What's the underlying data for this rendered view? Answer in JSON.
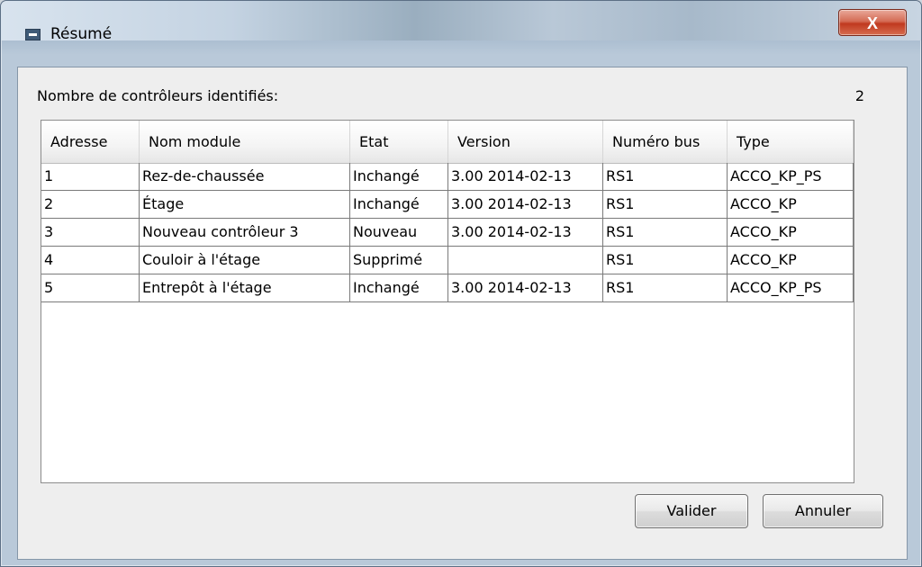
{
  "window": {
    "title": "Résumé",
    "close_label": "X"
  },
  "summary": {
    "count_label": "Nombre de contrôleurs identifiés:",
    "count_value": "2"
  },
  "table": {
    "columns": [
      "Adresse",
      "Nom module",
      "Etat",
      "Version",
      "Numéro bus",
      "Type"
    ],
    "rows": [
      [
        "1",
        "Rez-de-chaussée",
        "Inchangé",
        "3.00 2014-02-13",
        "RS1",
        "ACCO_KP_PS"
      ],
      [
        "2",
        "Étage",
        "Inchangé",
        "3.00 2014-02-13",
        "RS1",
        "ACCO_KP"
      ],
      [
        "3",
        "Nouveau contrôleur 3",
        "Nouveau",
        "3.00 2014-02-13",
        "RS1",
        "ACCO_KP"
      ],
      [
        "4",
        "Couloir à l'étage",
        "Supprimé",
        "",
        "RS1",
        "ACCO_KP"
      ],
      [
        "5",
        "Entrepôt à l'étage",
        "Inchangé",
        "3.00 2014-02-13",
        "RS1",
        "ACCO_KP_PS"
      ]
    ]
  },
  "buttons": {
    "ok_label": "Valider",
    "cancel_label": "Annuler"
  },
  "icons": {
    "window_icon": "app-window-icon",
    "close_icon": "close-icon"
  },
  "colors": {
    "close_button": "#c0391f",
    "client_background": "#eeeeee"
  }
}
